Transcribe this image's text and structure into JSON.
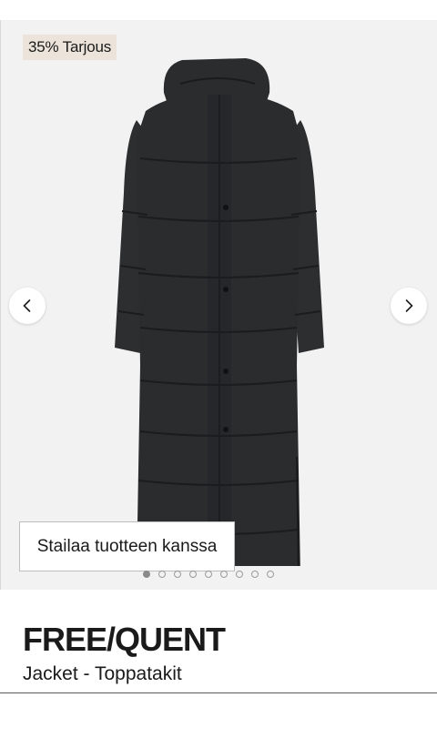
{
  "gallery": {
    "badge": "35% Tarjous",
    "style_button_label": "Stailaa tuotteen kanssa",
    "dots_total": 9,
    "active_dot": 0,
    "image_alt": "jacket-product-image",
    "prev_icon": "chevron-left-icon",
    "next_icon": "chevron-right-icon"
  },
  "product": {
    "brand": "FREE/QUENT",
    "category": "Jacket - Toppatakit"
  },
  "colors": {
    "gallery_bg": "#f2f2f2",
    "badge_bg": "#ece4da",
    "jacket": "#2b2c2e"
  }
}
